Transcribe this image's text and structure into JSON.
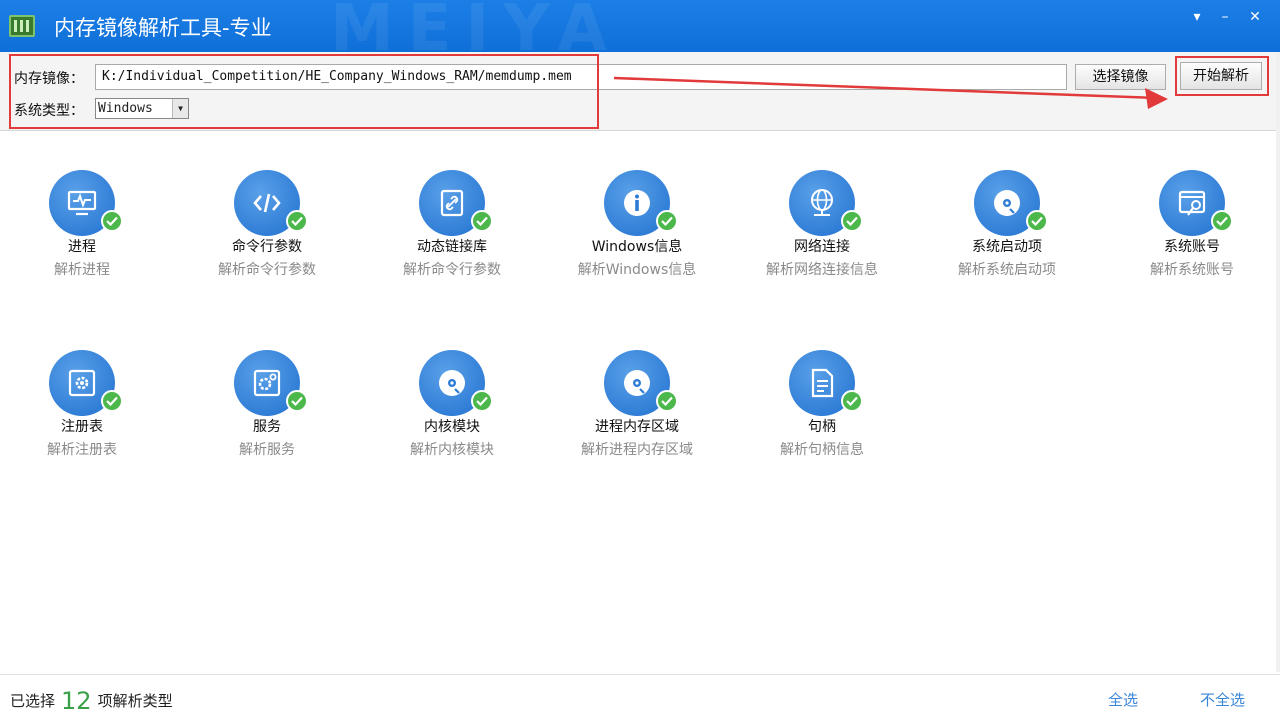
{
  "window": {
    "title": "内存镜像解析工具-专业",
    "watermark": "MEIYA",
    "minimize": "–",
    "close": "✕",
    "menu": "▾",
    "accent_color": "#1a7ce2"
  },
  "toolbar": {
    "image_label": "内存镜像：",
    "image_path": "K:/Individual_Competition/HE_Company_Windows_RAM/memdump.mem",
    "select_image_button": "选择镜像",
    "start_button": "开始解析",
    "os_label": "系统类型：",
    "os_value": "Windows"
  },
  "tiles": [
    {
      "title": "进程",
      "sub": "解析进程",
      "icon": "process-monitor-icon"
    },
    {
      "title": "命令行参数",
      "sub": "解析命令行参数",
      "icon": "code-icon"
    },
    {
      "title": "动态链接库",
      "sub": "解析命令行参数",
      "icon": "link-icon"
    },
    {
      "title": "Windows信息",
      "sub": "解析Windows信息",
      "icon": "info-icon"
    },
    {
      "title": "网络连接",
      "sub": "解析网络连接信息",
      "icon": "globe-network-icon"
    },
    {
      "title": "系统启动项",
      "sub": "解析系统启动项",
      "icon": "disc-icon"
    },
    {
      "title": "系统账号",
      "sub": "解析系统账号",
      "icon": "account-key-icon"
    },
    {
      "title": "注册表",
      "sub": "解析注册表",
      "icon": "registry-gear-icon"
    },
    {
      "title": "服务",
      "sub": "解析服务",
      "icon": "service-gear-icon"
    },
    {
      "title": "内核模块",
      "sub": "解析内核模块",
      "icon": "disc-icon"
    },
    {
      "title": "进程内存区域",
      "sub": "解析进程内存区域",
      "icon": "disc-icon"
    },
    {
      "title": "句柄",
      "sub": "解析句柄信息",
      "icon": "document-icon"
    }
  ],
  "status": {
    "prefix": "已选择",
    "count": "12",
    "suffix": "项解析类型",
    "select_all": "全选",
    "select_none": "不全选"
  }
}
